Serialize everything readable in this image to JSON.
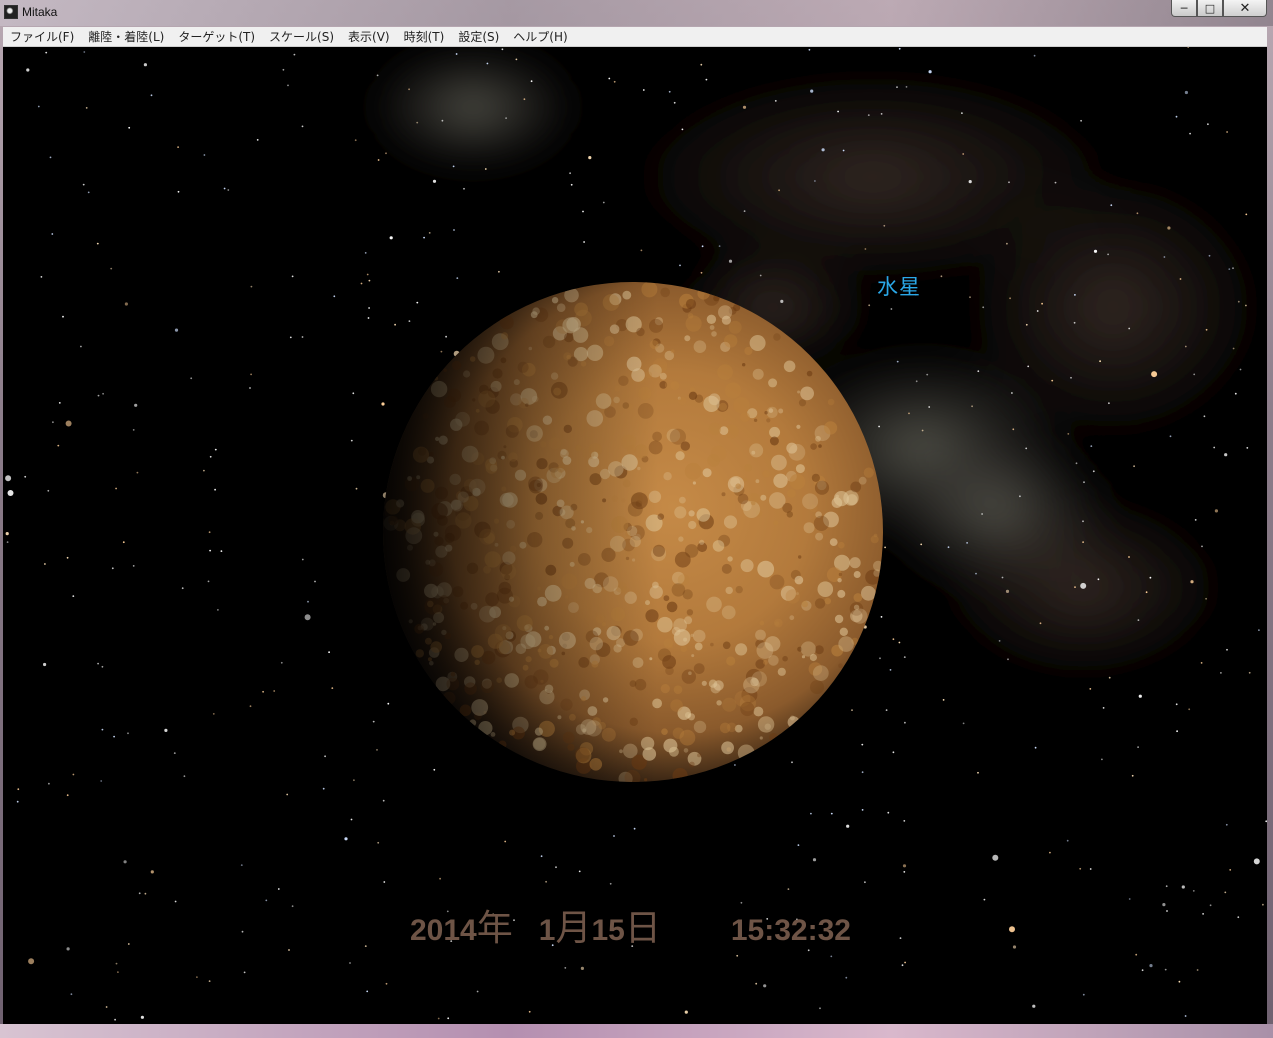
{
  "window": {
    "title": "Mitaka",
    "controls": {
      "minimize": "─",
      "maximize": "□",
      "close": "✕"
    }
  },
  "menu": {
    "items": [
      {
        "label": "ファイル(F)"
      },
      {
        "label": "離陸・着陸(L)"
      },
      {
        "label": "ターゲット(T)"
      },
      {
        "label": "スケール(S)"
      },
      {
        "label": "表示(V)"
      },
      {
        "label": "時刻(T)"
      },
      {
        "label": "設定(S)"
      },
      {
        "label": "ヘルプ(H)"
      }
    ]
  },
  "view": {
    "target_label": "水星",
    "label_color": "#2aa8e8",
    "planet_colors": {
      "light": "#e0c79a",
      "mid": "#b9803c",
      "dark": "#6b3a12"
    },
    "datetime": {
      "year": "2014",
      "year_unit": "年",
      "month": "1",
      "month_unit": "月",
      "day": "15",
      "day_unit": "日",
      "time": "15:32:32"
    }
  }
}
